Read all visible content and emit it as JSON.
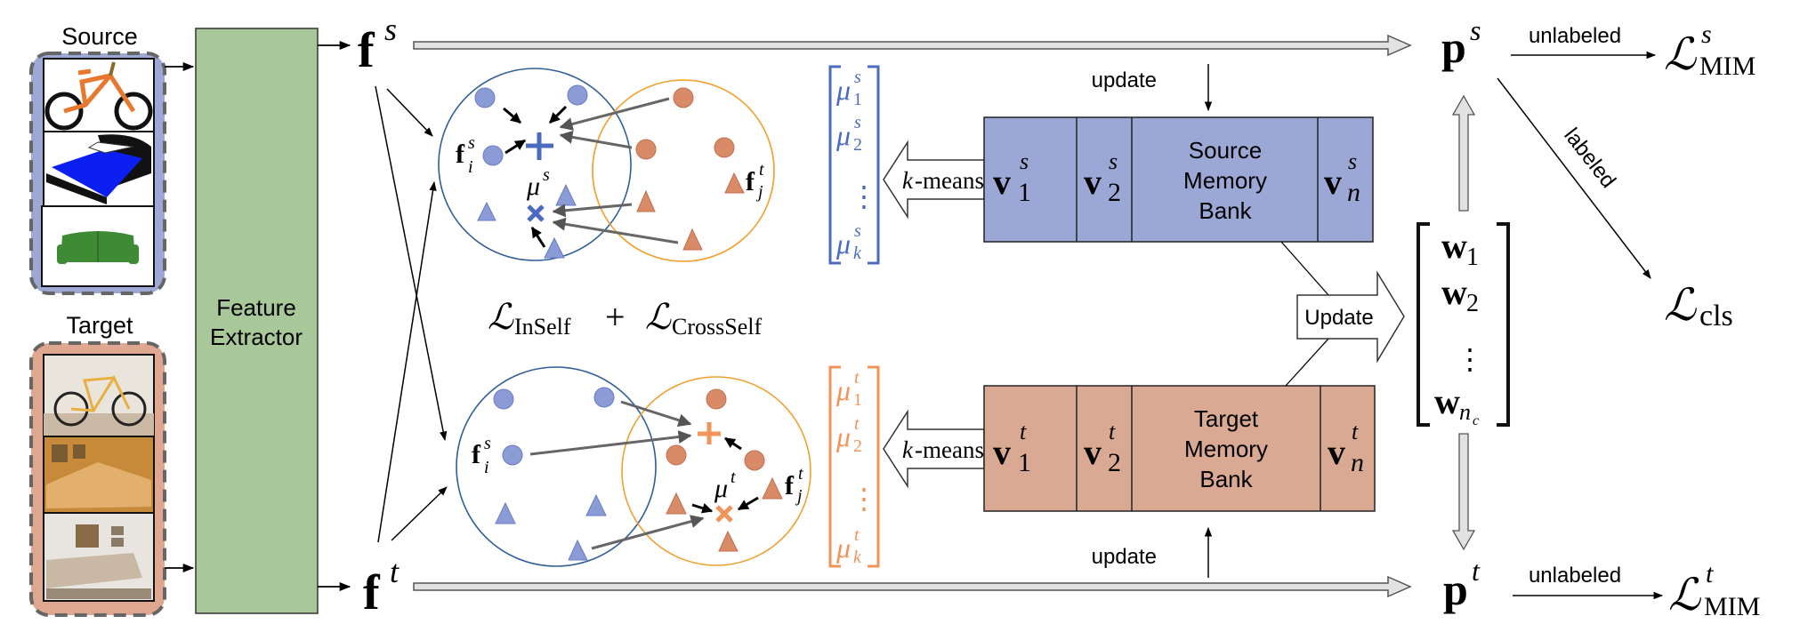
{
  "inputs": {
    "source_label": "Source",
    "target_label": "Target",
    "source_images": [
      "bicycle",
      "bed",
      "sofa"
    ],
    "target_images": [
      "bicycle",
      "bed",
      "sofa"
    ]
  },
  "feature_extractor": {
    "label_line1": "Feature",
    "label_line2": "Extractor"
  },
  "features": {
    "source": {
      "base": "f",
      "sup": "s"
    },
    "target": {
      "base": "f",
      "sup": "t"
    }
  },
  "clusters": {
    "top": {
      "source_point": {
        "base": "f",
        "sup": "s",
        "sub": "i"
      },
      "target_point": {
        "base": "f",
        "sup": "t",
        "sub": "j"
      },
      "centroid": {
        "base": "μ",
        "sup": "s"
      }
    },
    "bottom": {
      "source_point": {
        "base": "f",
        "sup": "s",
        "sub": "i"
      },
      "target_point": {
        "base": "f",
        "sup": "t",
        "sub": "j"
      },
      "centroid": {
        "base": "μ",
        "sup": "t"
      }
    },
    "loss": {
      "l1": "ℒ",
      "l1_sub": "InSelf",
      "plus": "+",
      "l2": "ℒ",
      "l2_sub": "CrossSelf"
    }
  },
  "centroid_vectors": {
    "source": {
      "items": [
        {
          "base": "μ",
          "sup": "s",
          "sub": "1"
        },
        {
          "base": "μ",
          "sup": "s",
          "sub": "2"
        },
        {
          "base": "μ",
          "sup": "s",
          "sub": "k"
        }
      ],
      "dots": "⋮"
    },
    "target": {
      "items": [
        {
          "base": "μ",
          "sup": "t",
          "sub": "1"
        },
        {
          "base": "μ",
          "sup": "t",
          "sub": "2"
        },
        {
          "base": "μ",
          "sup": "t",
          "sub": "k"
        }
      ],
      "dots": "⋮"
    }
  },
  "kmeans_label": {
    "k": "k",
    "rest": "-means"
  },
  "memory_banks": {
    "source": {
      "title_lines": [
        "Source",
        "Memory",
        "Bank"
      ],
      "cells": [
        {
          "base": "v",
          "sup": "s",
          "sub": "1"
        },
        {
          "base": "v",
          "sup": "s",
          "sub": "2"
        },
        {
          "base": "v",
          "sup": "s",
          "sub": "n"
        }
      ],
      "update_label": "update"
    },
    "target": {
      "title_lines": [
        "Target",
        "Memory",
        "Bank"
      ],
      "cells": [
        {
          "base": "v",
          "sup": "t",
          "sub": "1"
        },
        {
          "base": "v",
          "sup": "t",
          "sub": "2"
        },
        {
          "base": "v",
          "sup": "t",
          "sub": "n"
        }
      ],
      "update_label": "update"
    }
  },
  "update_arrow_label": "Update",
  "classifier_weights": {
    "items": [
      {
        "base": "w",
        "sub": "1"
      },
      {
        "base": "w",
        "sub": "2"
      },
      {
        "base": "w",
        "sub": "n",
        "subsub": "c"
      }
    ],
    "dots": "⋮"
  },
  "predictions": {
    "source": {
      "base": "p",
      "sup": "s"
    },
    "target": {
      "base": "p",
      "sup": "t"
    }
  },
  "losses": {
    "mim_source": {
      "base": "ℒ",
      "sup": "s",
      "sub": "MIM",
      "edge_label": "unlabeled"
    },
    "mim_target": {
      "base": "ℒ",
      "sup": "t",
      "sub": "MIM",
      "edge_label": "unlabeled"
    },
    "cls": {
      "base": "ℒ",
      "sub": "cls",
      "edge_label": "labeled"
    }
  },
  "colors": {
    "source_blue": "#4a6bbf",
    "source_point": "#8b9bd6",
    "target_orange": "#f0945a",
    "target_point": "#d98a66",
    "source_circle": "#2f5f9a",
    "target_circle": "#f0a030",
    "feature_green": "#a8c89a",
    "source_bank": "#9ba8d5",
    "target_bank": "#d9a994",
    "source_frame": "#9ea8d4",
    "target_frame": "#dfa78f"
  }
}
